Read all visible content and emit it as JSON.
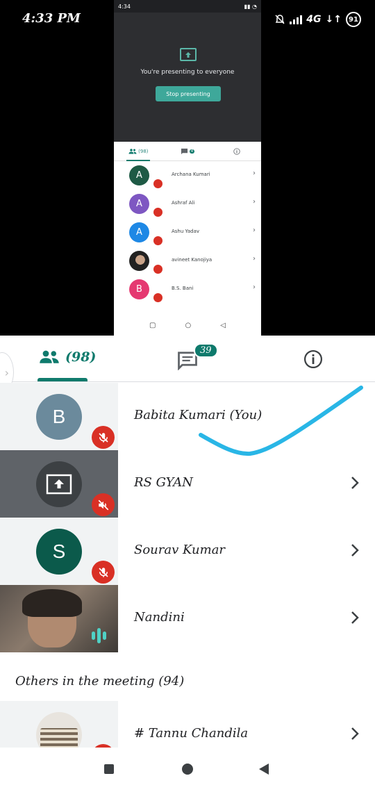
{
  "status_bar": {
    "time": "4:33 PM",
    "network": "4G",
    "battery": "91"
  },
  "shared_screen": {
    "status_time": "4:34",
    "presenting_text": "You're presenting to everyone",
    "stop_button": "Stop presenting",
    "people_count": "(98)",
    "chat_count": "4",
    "participants": [
      {
        "initial": "A",
        "name": "Archana Kumari",
        "color": "#1e5a45"
      },
      {
        "initial": "A",
        "name": "Ashraf Ali",
        "color": "#7e57c2"
      },
      {
        "initial": "A",
        "name": "Ashu Yadav",
        "color": "#1e88e5"
      },
      {
        "initial": "",
        "name": "avineet Kanojiya",
        "color": "#333333"
      },
      {
        "initial": "B",
        "name": "B.S. Bani",
        "color": "#e53971"
      }
    ]
  },
  "tabs": {
    "people_count": "(98)",
    "chat_badge": "39"
  },
  "participants": [
    {
      "initial": "B",
      "name": "Babita Kumari (You)",
      "avatar_color": "#6b8a9c"
    },
    {
      "initial": "",
      "name": "RS GYAN",
      "avatar_color": "#3c4043"
    },
    {
      "initial": "S",
      "name": "Sourav Kumar",
      "avatar_color": "#0b5a4b"
    },
    {
      "initial": "",
      "name": "Nandini",
      "avatar_color": "#6d6259"
    }
  ],
  "others": {
    "title": "Others in the meeting (94)",
    "first_name": "# Tannu Chandila"
  },
  "colors": {
    "accent": "#0e7a6c",
    "mic_off": "#d93025",
    "annotation": "#29b6e6"
  }
}
